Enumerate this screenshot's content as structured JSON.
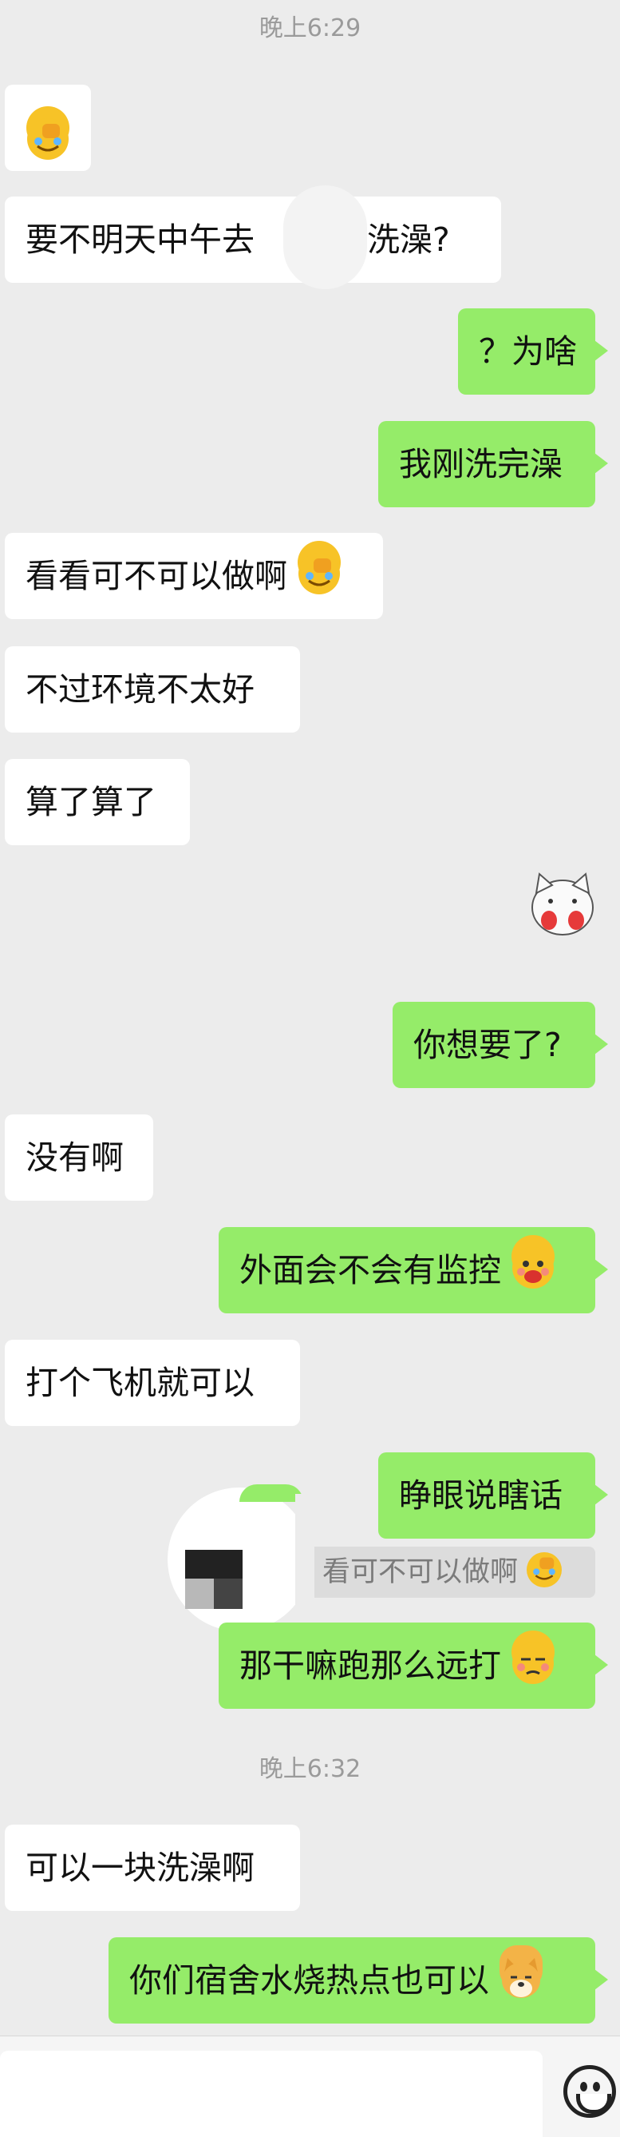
{
  "timestamps": [
    "晚上6:29",
    "晚上6:32"
  ],
  "messages": [
    {
      "side": "left",
      "text": "",
      "emoji": "facepalm-emoji"
    },
    {
      "side": "left",
      "text": "要不明天中午去",
      "text2": "外洗澡?"
    },
    {
      "side": "right",
      "text": "？为啥"
    },
    {
      "side": "right",
      "text": "我刚洗完澡"
    },
    {
      "side": "left",
      "text": "看看可不可以做啊",
      "emoji": "facepalm-emoji"
    },
    {
      "side": "left",
      "text": "不过环境不太好"
    },
    {
      "side": "left",
      "text": "算了算了"
    },
    {
      "side": "right",
      "text": "",
      "emoji": "cat-sticker"
    },
    {
      "side": "right",
      "text": "你想要了?"
    },
    {
      "side": "left",
      "text": "没有啊"
    },
    {
      "side": "right",
      "text": "外面会不会有监控",
      "emoji": "shy-face-emoji"
    },
    {
      "side": "left",
      "text": "打个飞机就可以"
    },
    {
      "side": "right",
      "text": "睁眼说瞎话"
    },
    {
      "side": "right",
      "text": "那干嘛跑那么远打",
      "emoji": "unamused-emoji"
    },
    {
      "side": "left",
      "text": "可以一块洗澡啊"
    },
    {
      "side": "right",
      "text": "你们宿舍水烧热点也可以",
      "emoji": "doge-emoji"
    }
  ],
  "quote": {
    "text": "看可不可以做啊"
  },
  "colors": {
    "outgoing": "#95ec69",
    "incoming": "#ffffff",
    "background": "#ececec"
  }
}
